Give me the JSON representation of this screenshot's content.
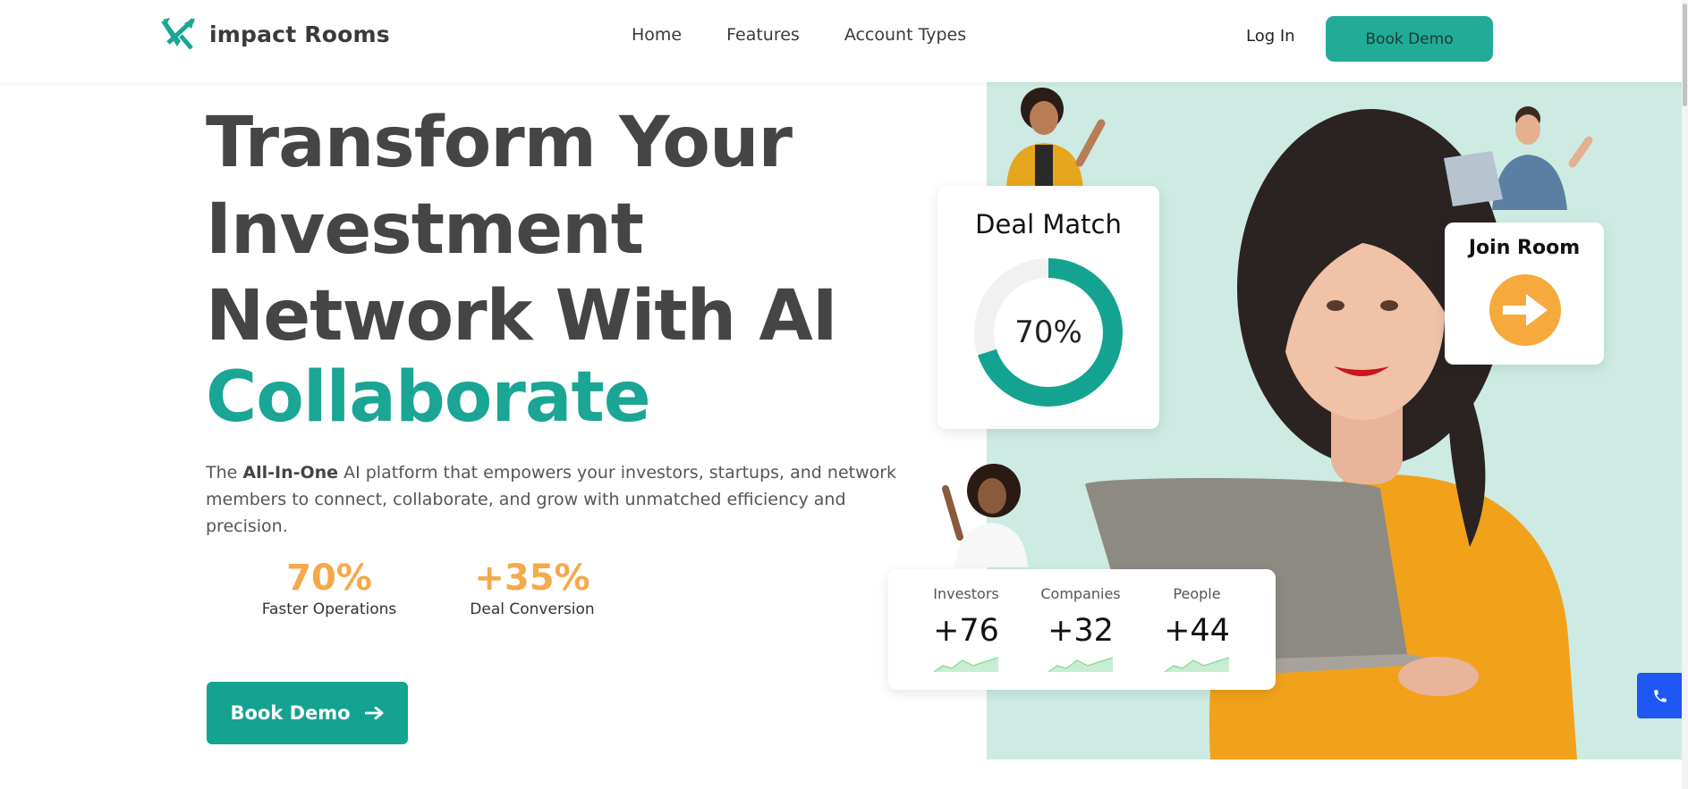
{
  "header": {
    "logo_text": "impact Rooms",
    "nav": [
      "Home",
      "Features",
      "Account Types"
    ],
    "login_label": "Log In",
    "book_demo_label": "Book Demo"
  },
  "hero": {
    "headline_lines": [
      "Transform Your",
      "Investment",
      "Network With AI"
    ],
    "headline_accent": "Collaborate",
    "desc_prefix": "The ",
    "desc_bold": "All-In-One",
    "desc_rest": " AI platform that empowers your investors, startups, and network members to connect, collaborate, and grow with unmatched efficiency and precision.",
    "stats": [
      {
        "value": "70%",
        "label": "Faster Operations"
      },
      {
        "value": "+35%",
        "label": "Deal Conversion"
      }
    ],
    "cta_label": "Book Demo"
  },
  "visual": {
    "deal_match": {
      "title": "Deal Match",
      "percent_label": "70%",
      "progress": 0.7
    },
    "join_room": {
      "title": "Join Room"
    },
    "metrics": [
      {
        "label": "Investors",
        "value": "+76"
      },
      {
        "label": "Companies",
        "value": "+32"
      },
      {
        "label": "People",
        "value": "+44"
      }
    ]
  },
  "colors": {
    "brand_teal": "#1aa594",
    "accent_orange": "#f4a94a",
    "mint_background": "#cdebe3",
    "call_button_blue": "#1e57f3"
  },
  "icons": [
    "logo-mark-icon",
    "arrow-right-icon",
    "phone-icon"
  ]
}
